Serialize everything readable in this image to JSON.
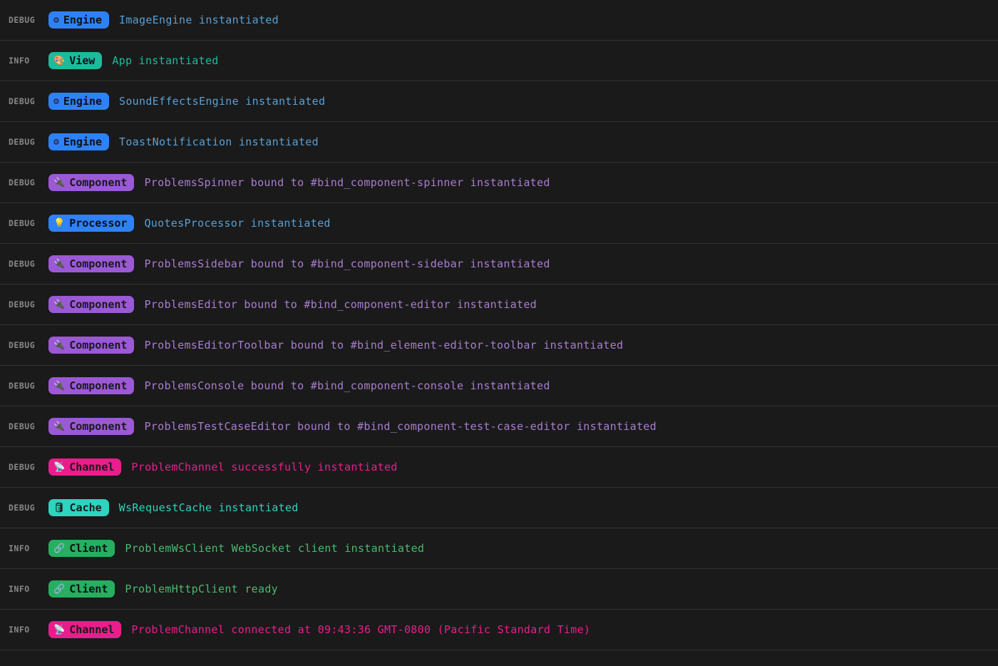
{
  "logs": [
    {
      "level": "DEBUG",
      "tagType": "engine",
      "tagIcon": "⚙",
      "tagLabel": "Engine",
      "message": "ImageEngine instantiated"
    },
    {
      "level": "INFO",
      "tagType": "view",
      "tagIcon": "🎨",
      "tagLabel": "View",
      "message": "App instantiated"
    },
    {
      "level": "DEBUG",
      "tagType": "engine",
      "tagIcon": "⚙",
      "tagLabel": "Engine",
      "message": "SoundEffectsEngine instantiated"
    },
    {
      "level": "DEBUG",
      "tagType": "engine",
      "tagIcon": "⚙",
      "tagLabel": "Engine",
      "message": "ToastNotification instantiated"
    },
    {
      "level": "DEBUG",
      "tagType": "component",
      "tagIcon": "🔌",
      "tagLabel": "Component",
      "message": "ProblemsSpinner bound to #bind_component-spinner instantiated"
    },
    {
      "level": "DEBUG",
      "tagType": "processor",
      "tagIcon": "💡",
      "tagLabel": "Processor",
      "message": "QuotesProcessor instantiated"
    },
    {
      "level": "DEBUG",
      "tagType": "component",
      "tagIcon": "🔌",
      "tagLabel": "Component",
      "message": "ProblemsSidebar bound to #bind_component-sidebar instantiated"
    },
    {
      "level": "DEBUG",
      "tagType": "component",
      "tagIcon": "🔌",
      "tagLabel": "Component",
      "message": "ProblemsEditor bound to #bind_component-editor instantiated"
    },
    {
      "level": "DEBUG",
      "tagType": "component",
      "tagIcon": "🔌",
      "tagLabel": "Component",
      "message": "ProblemsEditorToolbar bound to #bind_element-editor-toolbar instantiated"
    },
    {
      "level": "DEBUG",
      "tagType": "component",
      "tagIcon": "🔌",
      "tagLabel": "Component",
      "message": "ProblemsConsole bound to #bind_component-console instantiated"
    },
    {
      "level": "DEBUG",
      "tagType": "component",
      "tagIcon": "🔌",
      "tagLabel": "Component",
      "message": "ProblemsTestCaseEditor bound to #bind_component-test-case-editor instantiated"
    },
    {
      "level": "DEBUG",
      "tagType": "channel",
      "tagIcon": "📡",
      "tagLabel": "Channel",
      "message": "ProblemChannel successfully instantiated"
    },
    {
      "level": "DEBUG",
      "tagType": "cache",
      "tagIcon": "🛢",
      "tagLabel": "Cache",
      "message": "WsRequestCache instantiated"
    },
    {
      "level": "INFO",
      "tagType": "client",
      "tagIcon": "🔗",
      "tagLabel": "Client",
      "message": "ProblemWsClient WebSocket client instantiated"
    },
    {
      "level": "INFO",
      "tagType": "client",
      "tagIcon": "🔗",
      "tagLabel": "Client",
      "message": "ProblemHttpClient ready"
    },
    {
      "level": "INFO",
      "tagType": "channel",
      "tagIcon": "📡",
      "tagLabel": "Channel",
      "message": "ProblemChannel connected at 09:43:36 GMT-0800 (Pacific Standard Time)"
    }
  ]
}
